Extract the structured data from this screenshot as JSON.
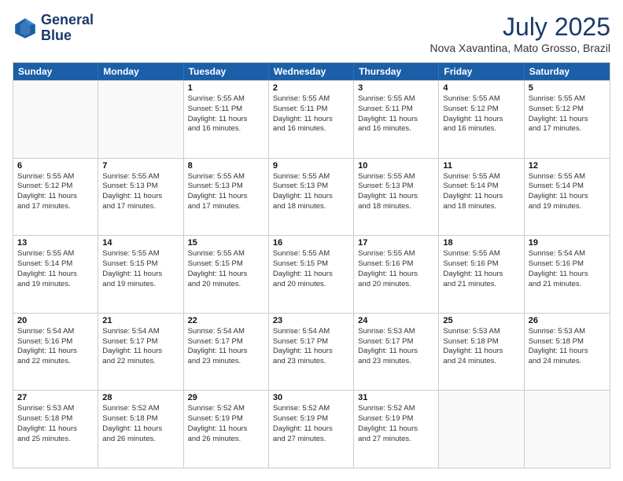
{
  "header": {
    "logo_line1": "General",
    "logo_line2": "Blue",
    "month_year": "July 2025",
    "location": "Nova Xavantina, Mato Grosso, Brazil"
  },
  "weekdays": [
    "Sunday",
    "Monday",
    "Tuesday",
    "Wednesday",
    "Thursday",
    "Friday",
    "Saturday"
  ],
  "weeks": [
    [
      {
        "day": "",
        "lines": [],
        "empty": true
      },
      {
        "day": "",
        "lines": [],
        "empty": true
      },
      {
        "day": "1",
        "lines": [
          "Sunrise: 5:55 AM",
          "Sunset: 5:11 PM",
          "Daylight: 11 hours",
          "and 16 minutes."
        ]
      },
      {
        "day": "2",
        "lines": [
          "Sunrise: 5:55 AM",
          "Sunset: 5:11 PM",
          "Daylight: 11 hours",
          "and 16 minutes."
        ]
      },
      {
        "day": "3",
        "lines": [
          "Sunrise: 5:55 AM",
          "Sunset: 5:11 PM",
          "Daylight: 11 hours",
          "and 16 minutes."
        ]
      },
      {
        "day": "4",
        "lines": [
          "Sunrise: 5:55 AM",
          "Sunset: 5:12 PM",
          "Daylight: 11 hours",
          "and 16 minutes."
        ]
      },
      {
        "day": "5",
        "lines": [
          "Sunrise: 5:55 AM",
          "Sunset: 5:12 PM",
          "Daylight: 11 hours",
          "and 17 minutes."
        ]
      }
    ],
    [
      {
        "day": "6",
        "lines": [
          "Sunrise: 5:55 AM",
          "Sunset: 5:12 PM",
          "Daylight: 11 hours",
          "and 17 minutes."
        ]
      },
      {
        "day": "7",
        "lines": [
          "Sunrise: 5:55 AM",
          "Sunset: 5:13 PM",
          "Daylight: 11 hours",
          "and 17 minutes."
        ]
      },
      {
        "day": "8",
        "lines": [
          "Sunrise: 5:55 AM",
          "Sunset: 5:13 PM",
          "Daylight: 11 hours",
          "and 17 minutes."
        ]
      },
      {
        "day": "9",
        "lines": [
          "Sunrise: 5:55 AM",
          "Sunset: 5:13 PM",
          "Daylight: 11 hours",
          "and 18 minutes."
        ]
      },
      {
        "day": "10",
        "lines": [
          "Sunrise: 5:55 AM",
          "Sunset: 5:13 PM",
          "Daylight: 11 hours",
          "and 18 minutes."
        ]
      },
      {
        "day": "11",
        "lines": [
          "Sunrise: 5:55 AM",
          "Sunset: 5:14 PM",
          "Daylight: 11 hours",
          "and 18 minutes."
        ]
      },
      {
        "day": "12",
        "lines": [
          "Sunrise: 5:55 AM",
          "Sunset: 5:14 PM",
          "Daylight: 11 hours",
          "and 19 minutes."
        ]
      }
    ],
    [
      {
        "day": "13",
        "lines": [
          "Sunrise: 5:55 AM",
          "Sunset: 5:14 PM",
          "Daylight: 11 hours",
          "and 19 minutes."
        ]
      },
      {
        "day": "14",
        "lines": [
          "Sunrise: 5:55 AM",
          "Sunset: 5:15 PM",
          "Daylight: 11 hours",
          "and 19 minutes."
        ]
      },
      {
        "day": "15",
        "lines": [
          "Sunrise: 5:55 AM",
          "Sunset: 5:15 PM",
          "Daylight: 11 hours",
          "and 20 minutes."
        ]
      },
      {
        "day": "16",
        "lines": [
          "Sunrise: 5:55 AM",
          "Sunset: 5:15 PM",
          "Daylight: 11 hours",
          "and 20 minutes."
        ]
      },
      {
        "day": "17",
        "lines": [
          "Sunrise: 5:55 AM",
          "Sunset: 5:16 PM",
          "Daylight: 11 hours",
          "and 20 minutes."
        ]
      },
      {
        "day": "18",
        "lines": [
          "Sunrise: 5:55 AM",
          "Sunset: 5:16 PM",
          "Daylight: 11 hours",
          "and 21 minutes."
        ]
      },
      {
        "day": "19",
        "lines": [
          "Sunrise: 5:54 AM",
          "Sunset: 5:16 PM",
          "Daylight: 11 hours",
          "and 21 minutes."
        ]
      }
    ],
    [
      {
        "day": "20",
        "lines": [
          "Sunrise: 5:54 AM",
          "Sunset: 5:16 PM",
          "Daylight: 11 hours",
          "and 22 minutes."
        ]
      },
      {
        "day": "21",
        "lines": [
          "Sunrise: 5:54 AM",
          "Sunset: 5:17 PM",
          "Daylight: 11 hours",
          "and 22 minutes."
        ]
      },
      {
        "day": "22",
        "lines": [
          "Sunrise: 5:54 AM",
          "Sunset: 5:17 PM",
          "Daylight: 11 hours",
          "and 23 minutes."
        ]
      },
      {
        "day": "23",
        "lines": [
          "Sunrise: 5:54 AM",
          "Sunset: 5:17 PM",
          "Daylight: 11 hours",
          "and 23 minutes."
        ]
      },
      {
        "day": "24",
        "lines": [
          "Sunrise: 5:53 AM",
          "Sunset: 5:17 PM",
          "Daylight: 11 hours",
          "and 23 minutes."
        ]
      },
      {
        "day": "25",
        "lines": [
          "Sunrise: 5:53 AM",
          "Sunset: 5:18 PM",
          "Daylight: 11 hours",
          "and 24 minutes."
        ]
      },
      {
        "day": "26",
        "lines": [
          "Sunrise: 5:53 AM",
          "Sunset: 5:18 PM",
          "Daylight: 11 hours",
          "and 24 minutes."
        ]
      }
    ],
    [
      {
        "day": "27",
        "lines": [
          "Sunrise: 5:53 AM",
          "Sunset: 5:18 PM",
          "Daylight: 11 hours",
          "and 25 minutes."
        ]
      },
      {
        "day": "28",
        "lines": [
          "Sunrise: 5:52 AM",
          "Sunset: 5:18 PM",
          "Daylight: 11 hours",
          "and 26 minutes."
        ]
      },
      {
        "day": "29",
        "lines": [
          "Sunrise: 5:52 AM",
          "Sunset: 5:19 PM",
          "Daylight: 11 hours",
          "and 26 minutes."
        ]
      },
      {
        "day": "30",
        "lines": [
          "Sunrise: 5:52 AM",
          "Sunset: 5:19 PM",
          "Daylight: 11 hours",
          "and 27 minutes."
        ]
      },
      {
        "day": "31",
        "lines": [
          "Sunrise: 5:52 AM",
          "Sunset: 5:19 PM",
          "Daylight: 11 hours",
          "and 27 minutes."
        ]
      },
      {
        "day": "",
        "lines": [],
        "empty": true
      },
      {
        "day": "",
        "lines": [],
        "empty": true
      }
    ]
  ]
}
